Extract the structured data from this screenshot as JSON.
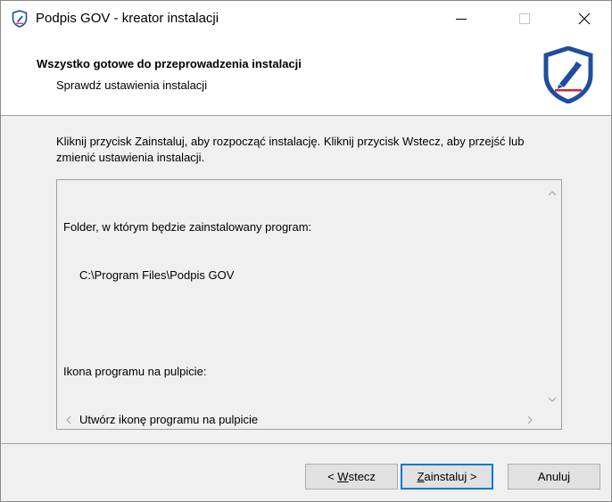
{
  "window": {
    "title": "Podpis GOV - kreator instalacji"
  },
  "header": {
    "title": "Wszystko gotowe do przeprowadzenia instalacji",
    "subtitle": "Sprawdź ustawienia instalacji"
  },
  "instruction": "Kliknij przycisk Zainstaluj, aby rozpocząć instalację. Kliknij przycisk Wstecz, aby przejść lub zmienić ustawienia instalacji.",
  "summary": {
    "lines": [
      {
        "text": "Folder, w którym będzie zainstalowany program:",
        "indent": false
      },
      {
        "text": "C:\\Program Files\\Podpis GOV",
        "indent": true
      },
      {
        "text": "",
        "indent": false
      },
      {
        "text": "Ikona programu na pulpicie:",
        "indent": false
      },
      {
        "text": "Utwórz ikonę programu na pulpicie",
        "indent": true
      }
    ]
  },
  "buttons": {
    "back_prefix": "< ",
    "back_mnemonic": "W",
    "back_rest": "stecz",
    "install_mnemonic": "Z",
    "install_rest": "ainstaluj >",
    "cancel": "Anuluj"
  },
  "colors": {
    "logo_blue": "#1f4e9e",
    "logo_red": "#d0282e",
    "focus_blue": "#0078d7"
  },
  "icons": {
    "app": "shield-pen-icon",
    "minimize": "minimize-icon",
    "maximize": "maximize-icon",
    "close": "close-icon"
  }
}
